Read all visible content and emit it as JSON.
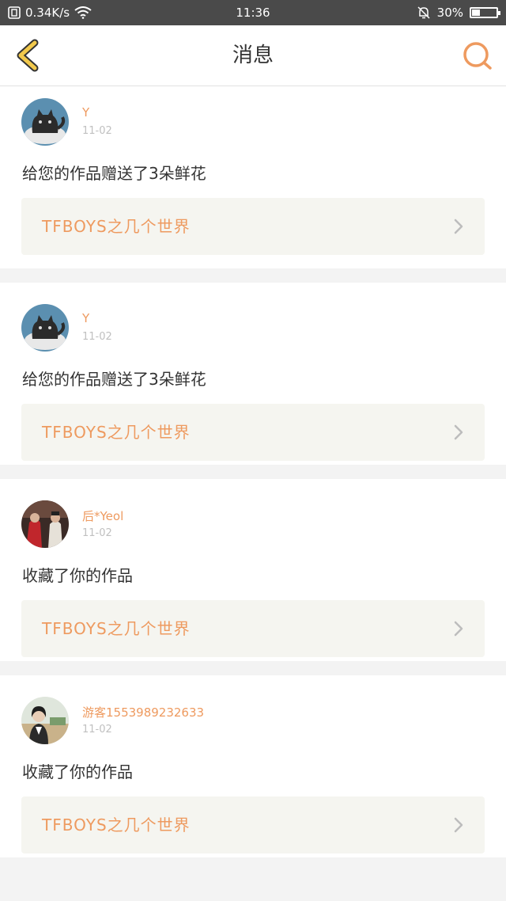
{
  "status_bar": {
    "net_speed": "0.34K/s",
    "time": "11:36",
    "battery": "30%",
    "battery_level": 0.3
  },
  "header": {
    "title": "消息",
    "back_icon": "chevron-left-icon",
    "search_icon": "search-icon"
  },
  "colors": {
    "accent": "#ee9a5f",
    "back_accent": "#f2c94c"
  },
  "messages": [
    {
      "user": "Y",
      "date": "11-02",
      "text": "给您的作品赠送了3朵鲜花",
      "work_title": "TFBOYS之几个世界",
      "avatar": "cat"
    },
    {
      "user": "Y",
      "date": "11-02",
      "text": "给您的作品赠送了3朵鲜花",
      "work_title": "TFBOYS之几个世界",
      "avatar": "cat"
    },
    {
      "user": "后*Yeol",
      "date": "11-02",
      "text": "收藏了你的作品",
      "work_title": "TFBOYS之几个世界",
      "avatar": "people"
    },
    {
      "user": "游客1553989232633",
      "date": "11-02",
      "text": "收藏了你的作品",
      "work_title": "TFBOYS之几个世界",
      "avatar": "girl"
    }
  ]
}
